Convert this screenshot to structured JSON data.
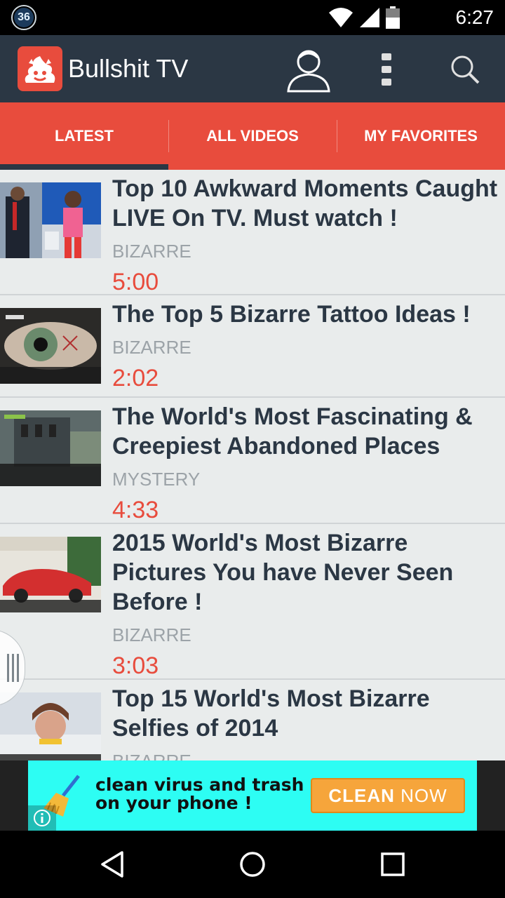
{
  "status_bar": {
    "notification_badge": "36",
    "time": "6:27"
  },
  "app_bar": {
    "title": "Bullshit TV",
    "icons": [
      "app-logo-icon",
      "profile-icon",
      "overflow-menu-icon",
      "search-icon"
    ]
  },
  "tabs": [
    {
      "label": "LATEST",
      "active": true
    },
    {
      "label": "ALL VIDEOS",
      "active": false
    },
    {
      "label": "MY FAVORITES",
      "active": false
    }
  ],
  "videos": [
    {
      "title": "Top 10 Awkward Moments Caught LIVE On TV. Must watch !",
      "category": "BIZARRE",
      "duration": "5:00"
    },
    {
      "title": "The Top 5 Bizarre Tattoo Ideas !",
      "category": "BIZARRE",
      "duration": "2:02"
    },
    {
      "title": "The World's Most Fascinating & Creepiest Abandoned Places",
      "category": "MYSTERY",
      "duration": "4:33"
    },
    {
      "title": "2015 World's Most Bizarre Pictures You have Never Seen Before !",
      "category": "BIZARRE",
      "duration": "3:03"
    },
    {
      "title": "Top 15 World's Most Bizarre Selfies of 2014",
      "category": "BIZARRE",
      "duration": ""
    }
  ],
  "ad": {
    "line1": "clean virus and trash",
    "line2": "on your phone !",
    "button_word1": "CLEAN",
    "button_word2": "NOW"
  },
  "colors": {
    "primary_dark": "#2b3744",
    "accent": "#e84c3d",
    "list_bg": "#e9ecec",
    "ad_bg": "#2dfdf3",
    "ad_button": "#f6a53b"
  }
}
